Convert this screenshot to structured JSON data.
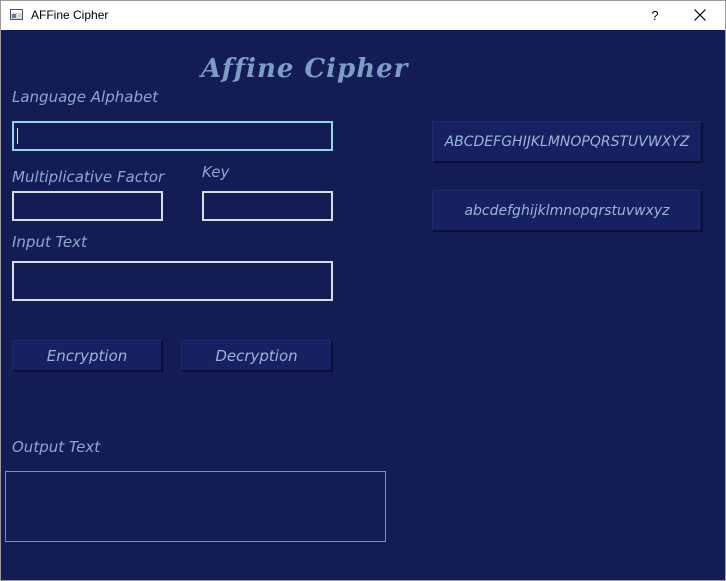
{
  "window": {
    "title": "AFFine Cipher",
    "help_label": "?"
  },
  "app": {
    "heading": "Affine Cipher"
  },
  "form": {
    "language_alphabet_label": "Language Alphabet",
    "language_alphabet_value": "",
    "multiplicative_factor_label": "Multiplicative Factor",
    "multiplicative_factor_value": "",
    "key_label": "Key",
    "key_value": "",
    "input_text_label": "Input Text",
    "input_text_value": "",
    "output_text_label": "Output Text",
    "output_text_value": ""
  },
  "buttons": {
    "encryption": "Encryption",
    "decryption": "Decryption",
    "uppercase_alphabet": "ABCDEFGHIJKLMNOPQRSTUVWXYZ",
    "lowercase_alphabet": "abcdefghijklmnopqrstuvwxyz"
  },
  "colors": {
    "background": "#141c55",
    "label_text": "#8ea7cf",
    "focus_border": "#8fd6e8"
  }
}
